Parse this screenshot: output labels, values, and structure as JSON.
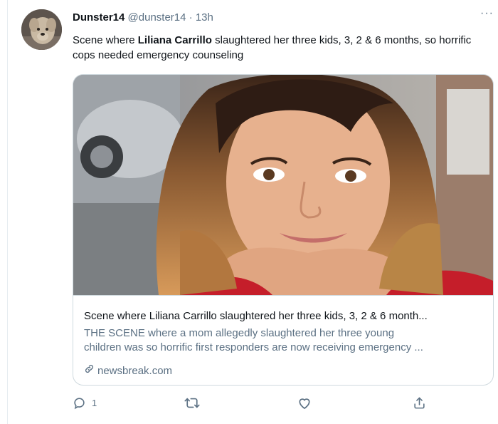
{
  "tweet": {
    "display_name": "Dunster14",
    "handle": "@dunster14",
    "separator": "·",
    "time": "13h",
    "more_label": "···",
    "text_before": "Scene where ",
    "text_highlight": "Liliana Carrillo",
    "text_after": " slaughtered her three kids, 3, 2 & 6 months, so horrific cops needed emergency counseling"
  },
  "card": {
    "title": "Scene where Liliana Carrillo slaughtered her three kids, 3, 2 & 6 month...",
    "description_line1": "THE SCENE where a mom allegedly slaughtered her three young",
    "description_line2": "children was so horrific first responders are now receiving emergency ...",
    "domain": "newsbreak.com",
    "domain_icon": "link-icon"
  },
  "actions": {
    "reply_count": "1",
    "retweet_count": "",
    "like_count": ""
  },
  "icons": [
    "reply-icon",
    "retweet-icon",
    "like-icon",
    "share-icon",
    "more-icon"
  ],
  "colors": {
    "text": "#0f1419",
    "secondary": "#5b7083",
    "border": "#cfd9de"
  }
}
